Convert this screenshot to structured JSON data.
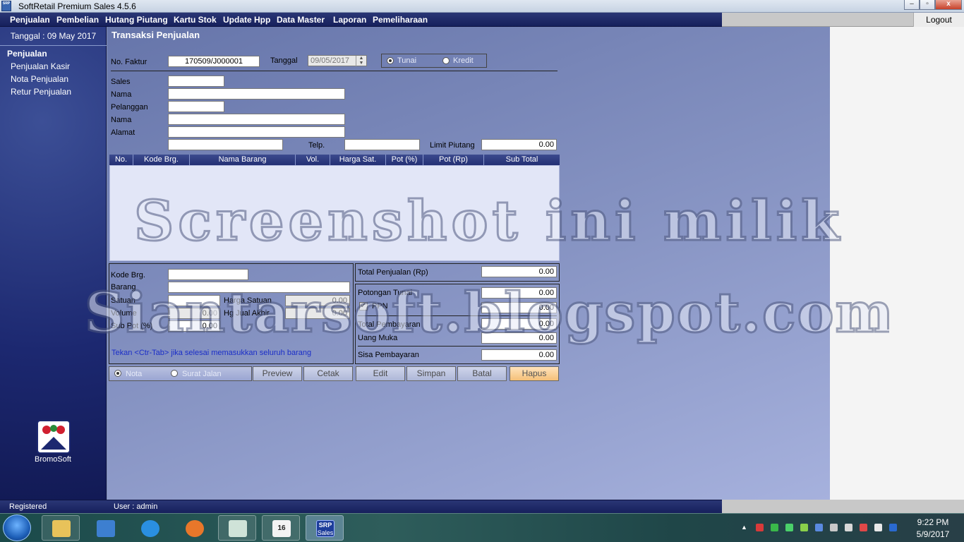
{
  "window": {
    "title": "SoftRetail Premium Sales 4.5.6",
    "icon_text": "SRP",
    "buttons": [
      "–",
      "▫",
      "x"
    ]
  },
  "menu": [
    "Penjualan",
    "Pembelian",
    "Hutang Piutang",
    "Kartu Stok",
    "Update Hpp",
    "Data Master",
    "Laporan",
    "Pemeliharaan"
  ],
  "logout_label": "Logout",
  "sidebar": {
    "date_label": "Tanggal : 09 May 2017",
    "section_title": "Penjualan",
    "items": [
      "Penjualan Kasir",
      "Nota Penjualan",
      "Retur Penjualan"
    ],
    "logo_name": "BromoSoft"
  },
  "form": {
    "title": "Transaksi Penjualan",
    "no_faktur_label": "No. Faktur",
    "no_faktur_value": "170509/J000001",
    "tanggal_label": "Tanggal",
    "tanggal_value": "09/05/2017",
    "payment_options": [
      "Tunai",
      "Kredit"
    ],
    "payment_selected": "Tunai",
    "sales_label": "Sales",
    "nama_label": "Nama",
    "pelanggan_label": "Pelanggan",
    "nama2_label": "Nama",
    "alamat_label": "Alamat",
    "telp_label": "Telp.",
    "limit_piutang_label": "Limit Piutang",
    "limit_piutang_value": "0.00"
  },
  "grid": {
    "columns": [
      "No.",
      "Kode Brg.",
      "Nama Barang",
      "Vol.",
      "Harga Sat.",
      "Pot (%)",
      "Pot (Rp)",
      "Sub Total"
    ]
  },
  "item_entry": {
    "kode_label": "Kode Brg.",
    "barang_label": "Barang",
    "satuan_label": "Satuan",
    "harga_satuan_label": "Harga Satuan",
    "harga_satuan_value": "0.00",
    "volume_label": "Volume",
    "volume_value": "0.00",
    "hg_jual_label": "Hg Jual Akhir",
    "hg_jual_value": "0.00",
    "sub_pot_label": "Sub Pot (%)",
    "sub_pot_value": "0.00",
    "hint": "Tekan <Ctr-Tab> jika selesai memasukkan seluruh barang"
  },
  "totals": {
    "total_penjualan_label": "Total Penjualan (Rp)",
    "total_penjualan_value": "0.00",
    "potongan_tunai_label": "Potongan Tunai",
    "potongan_tunai_value": "0.00",
    "ppn_label": "PPN",
    "ppn_value": "0.00",
    "total_pembayaran_label": "Total Pembayaran",
    "total_pembayaran_value": "0.00",
    "uang_muka_label": "Uang Muka",
    "uang_muka_value": "0.00",
    "sisa_pembayaran_label": "Sisa Pembayaran",
    "sisa_pembayaran_value": "0.00"
  },
  "print_options": [
    "Nota",
    "Surat Jalan"
  ],
  "buttons": {
    "preview": "Preview",
    "cetak": "Cetak",
    "edit": "Edit",
    "simpan": "Simpan",
    "batal": "Batal",
    "hapus": "Hapus"
  },
  "status": {
    "registered": "Registered",
    "user": "User : admin"
  },
  "watermark": {
    "line1": "Screenshot ini milik",
    "line2": "Siantarsoft.blogspot.com"
  },
  "taskbar": {
    "time": "9:22 PM",
    "date": "5/9/2017",
    "calendar_day": "16",
    "srp_label": "SRP",
    "srp_sub": "Sales"
  },
  "colors": {
    "menubar": "#1c2870",
    "main_bg": "#8895c4",
    "hapus_btn": "#f5c078",
    "hint_text": "#1b2ec8"
  }
}
